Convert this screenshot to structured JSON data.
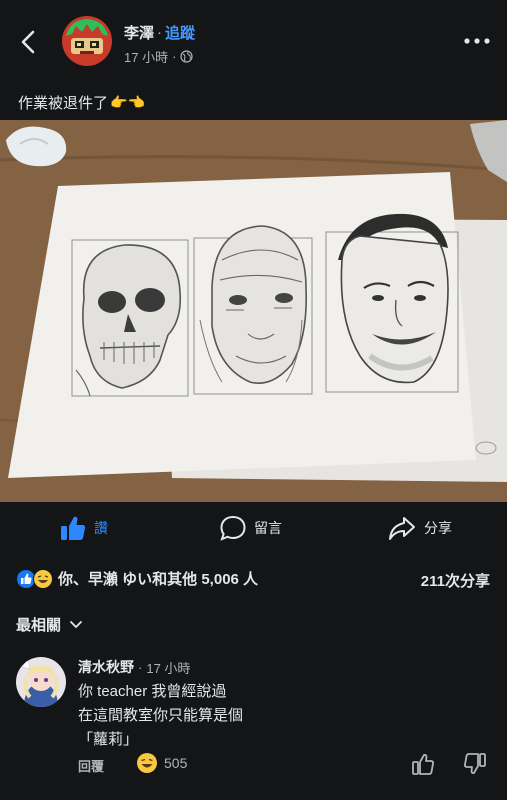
{
  "post": {
    "author": "李澤",
    "separator": "·",
    "follow_label": "追蹤",
    "time": "17 小時",
    "time_sep": "·",
    "caption": "作業被退件了",
    "caption_emojis": "👉👈"
  },
  "actions": {
    "like": "讚",
    "comment": "留言",
    "share": "分享"
  },
  "reactions": {
    "summary": "你、早瀨 ゆい和其他 5,006 人",
    "shares": "211次分享"
  },
  "sort": {
    "label": "最相關"
  },
  "comment": {
    "name": "清水秋野",
    "time_sep": "·",
    "time": "17 小時",
    "lines": [
      "你 teacher 我曾經說過",
      "在這間教室你只能算是個",
      "「蘿莉」"
    ],
    "reply_label": "回覆",
    "reaction_count": "505"
  },
  "colors": {
    "background": "#141517",
    "link_blue": "#4599ff",
    "like_blue": "#2d88ff",
    "secondary_text": "#b0b3b8"
  }
}
